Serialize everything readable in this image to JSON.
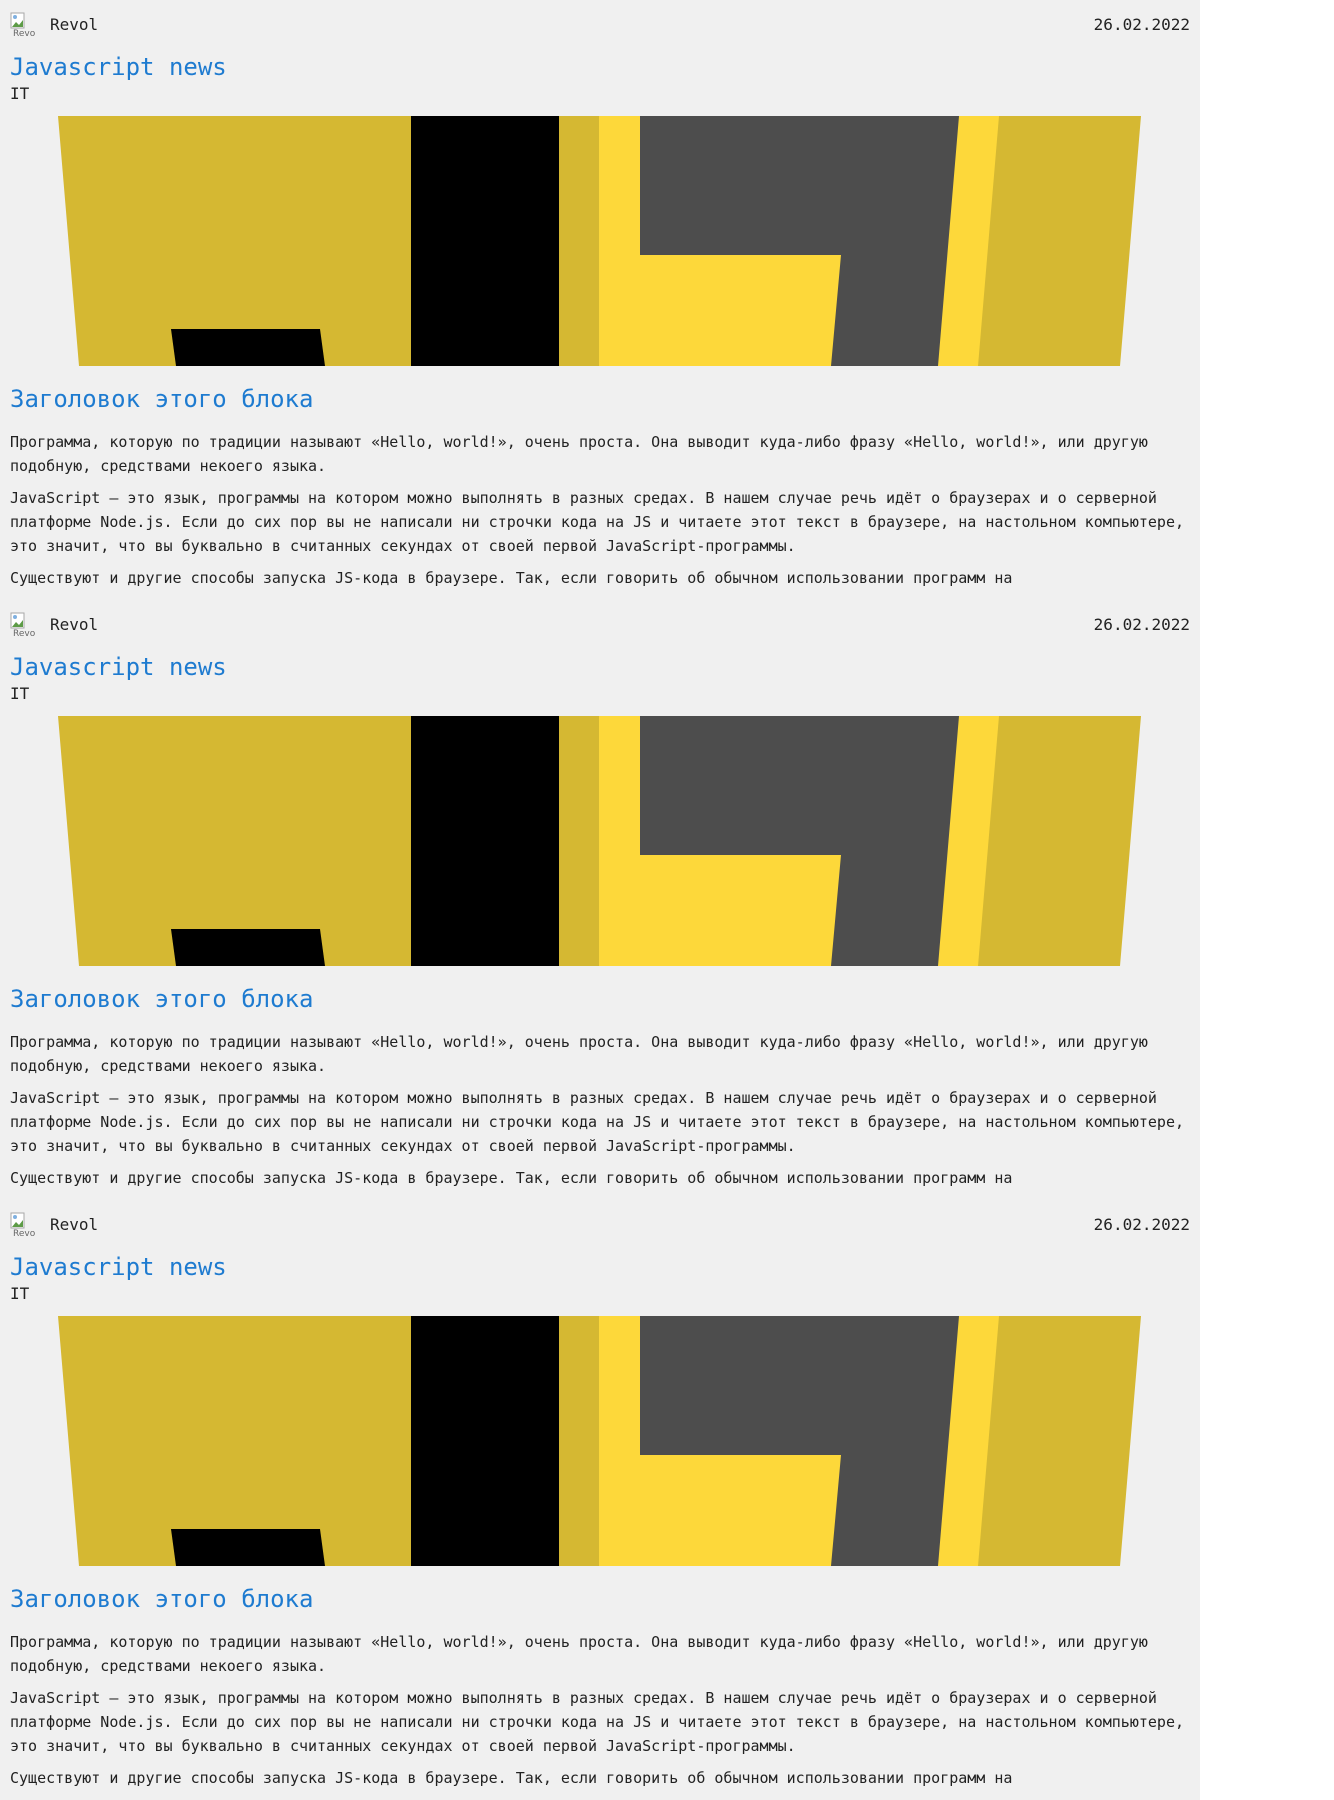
{
  "posts": [
    {
      "author": "Revol",
      "avatar_alt": "Revol",
      "date": "26.02.2022",
      "title": "Javascript news",
      "category": "IT",
      "image_icon": "javascript-logo-crop",
      "block_title": "Заголовок этого блока",
      "paragraphs": [
        "Программа, которую по традиции называют «Hello, world!», очень проста. Она выводит куда-либо фразу «Hello, world!», или другую подобную, средствами некоего языка.",
        "JavaScript — это язык, программы на котором можно выполнять в разных средах. В нашем случае речь идёт о браузерах и о серверной платформе Node.js. Если до сих пор вы не написали ни строчки кода на JS и читаете этот текст в браузере, на настольном компьютере, это значит, что вы буквально в считанных секундах от своей первой JavaScript-программы.",
        "Существуют и другие способы запуска JS-кода в браузере. Так, если говорить об обычном использовании программ на"
      ]
    },
    {
      "author": "Revol",
      "avatar_alt": "Revol",
      "date": "26.02.2022",
      "title": "Javascript news",
      "category": "IT",
      "image_icon": "javascript-logo-crop",
      "block_title": "Заголовок этого блока",
      "paragraphs": [
        "Программа, которую по традиции называют «Hello, world!», очень проста. Она выводит куда-либо фразу «Hello, world!», или другую подобную, средствами некоего языка.",
        "JavaScript — это язык, программы на котором можно выполнять в разных средах. В нашем случае речь идёт о браузерах и о серверной платформе Node.js. Если до сих пор вы не написали ни строчки кода на JS и читаете этот текст в браузере, на настольном компьютере, это значит, что вы буквально в считанных секундах от своей первой JavaScript-программы.",
        "Существуют и другие способы запуска JS-кода в браузере. Так, если говорить об обычном использовании программ на"
      ]
    },
    {
      "author": "Revol",
      "avatar_alt": "Revol",
      "date": "26.02.2022",
      "title": "Javascript news",
      "category": "IT",
      "image_icon": "javascript-logo-crop",
      "block_title": "Заголовок этого блока",
      "paragraphs": [
        "Программа, которую по традиции называют «Hello, world!», очень проста. Она выводит куда-либо фразу «Hello, world!», или другую подобную, средствами некоего языка.",
        "JavaScript — это язык, программы на котором можно выполнять в разных средах. В нашем случае речь идёт о браузерах и о серверной платформе Node.js. Если до сих пор вы не написали ни строчки кода на JS и читаете этот текст в браузере, на настольном компьютере, это значит, что вы буквально в считанных секундах от своей первой JavaScript-программы.",
        "Существуют и другие способы запуска JS-кода в браузере. Так, если говорить об обычном использовании программ на"
      ]
    }
  ],
  "colors": {
    "page_background": "#f0f0f0",
    "link": "#1e7bd0",
    "text": "#222222",
    "image_gold": "#d5b832",
    "image_yellow": "#fdd83a",
    "image_dark": "#4d4d4d",
    "image_black": "#000000"
  }
}
